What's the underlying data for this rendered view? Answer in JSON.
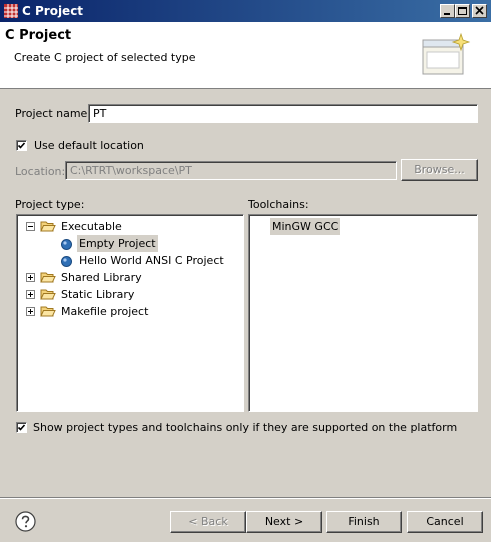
{
  "window": {
    "title": "C Project"
  },
  "banner": {
    "title": "C Project",
    "description": "Create C project of selected type"
  },
  "form": {
    "project_name_label": "Project name:",
    "project_name_value": "PT",
    "use_default_location_label": "Use default location",
    "use_default_location_checked": true,
    "location_label": "Location:",
    "location_value": "C:\\RTRT\\workspace\\PT",
    "browse_label": "Browse..."
  },
  "project_type": {
    "label": "Project type:",
    "items": [
      {
        "label": "Executable",
        "expanded": true,
        "children": [
          {
            "label": "Empty Project",
            "selected": true
          },
          {
            "label": "Hello World ANSI C Project"
          }
        ]
      },
      {
        "label": "Shared Library",
        "expanded": false
      },
      {
        "label": "Static Library",
        "expanded": false
      },
      {
        "label": "Makefile project",
        "expanded": false
      }
    ]
  },
  "toolchains": {
    "label": "Toolchains:",
    "items": [
      "MinGW GCC"
    ]
  },
  "filter": {
    "label": "Show project types and toolchains only if they are supported on the platform",
    "checked": true
  },
  "buttons": {
    "back": "< Back",
    "next": "Next >",
    "finish": "Finish",
    "cancel": "Cancel"
  },
  "icons": {
    "window": "eclipse-icon",
    "help": "help-icon",
    "wizard": "wizard-banner-icon"
  }
}
